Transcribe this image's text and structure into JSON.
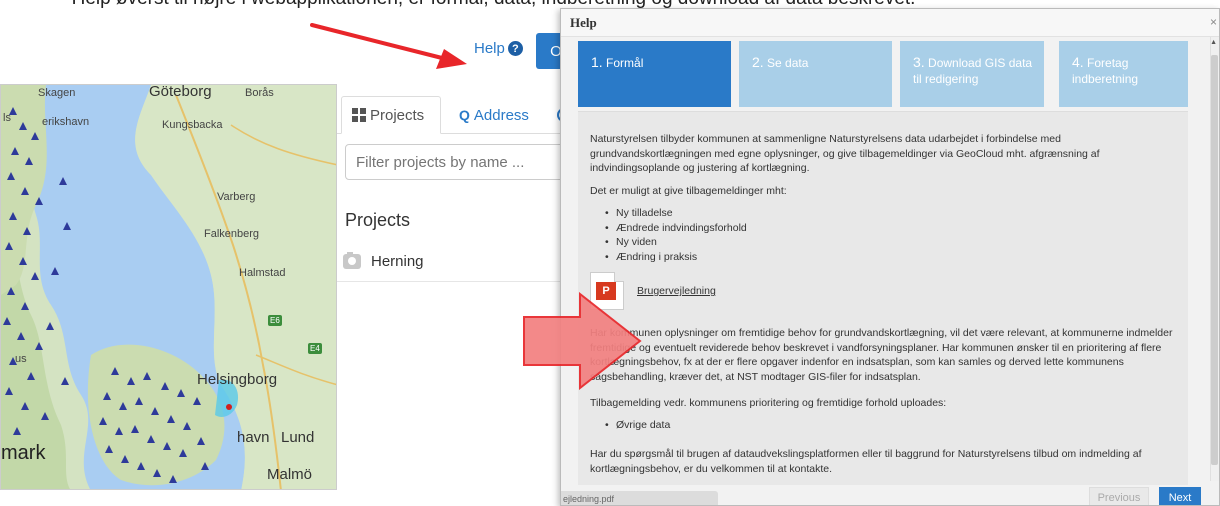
{
  "caption": {
    "text": "- Help   øverst til højre i webapplikationen, er formål, data, indberetning og download af data beskrevet."
  },
  "header": {
    "help_label": "Help",
    "help_icon": "question-circle-icon",
    "o_button_label": "O"
  },
  "map": {
    "labels": {
      "skagen": "Skagen",
      "goteborg": "Göteborg",
      "boras": "Borås",
      "frederikshavn": "erikshavn",
      "kungsbacka": "Kungsbacka",
      "varberg": "Varberg",
      "falkenberg": "Falkenberg",
      "halmstad": "Halmstad",
      "helsingborg": "Helsingborg",
      "lund": "Lund",
      "malmo": "Malmö",
      "havn": "havn",
      "mark": "mark",
      "is": "ls",
      "rus": "us"
    },
    "roads": {
      "e6": "E6",
      "e4": "E4"
    }
  },
  "side_panel": {
    "tabs": [
      {
        "label": "Projects",
        "icon": "grid-icon"
      },
      {
        "label": "Address",
        "icon": "search-icon"
      }
    ],
    "filter_placeholder": "Filter projects by name ...",
    "projects_heading": "Projects",
    "projects": [
      {
        "name": "Herning",
        "icon": "camera-icon"
      }
    ]
  },
  "dialog": {
    "title": "Help",
    "close_glyph": "×",
    "steps": [
      {
        "num": "1.",
        "label": "Formål"
      },
      {
        "num": "2.",
        "label": "Se data"
      },
      {
        "num": "3.",
        "label": "Download GIS data til redigering"
      },
      {
        "num": "4.",
        "label": "Foretag indberetning"
      }
    ],
    "para1": "Naturstyrelsen tilbyder kommunen at sammenligne Naturstyrelsens data udarbejdet i forbindelse med grundvandskortlægningen med egne oplysninger, og give tilbagemeldinger via GeoCloud mht. afgrænsning af indvindingsoplande og justering af kortlægning.",
    "para2": "Det er muligt at give tilbagemeldinger mht:",
    "list1": [
      "Ny tilladelse",
      "Ændrede indvindingsforhold",
      "Ny viden",
      "Ændring i praksis"
    ],
    "pdf_link": "Brugervejledning",
    "pdf_badge": "P",
    "para3": "Har kommunen oplysninger om fremtidige behov for grundvandskortlægning, vil det være relevant, at kommunerne indmelder fremtidige og eventuelt reviderede behov beskrevet i vandforsyningsplaner. Har kommunen ønsker til en prioritering af flere kortlægningsbehov, fx at der er flere opgaver indenfor en indsatsplan, som kan samles og derved lette kommunens sagsbehandling, kræver det, at NST modtager GIS-filer for indsatsplan.",
    "para4": "Tilbagemelding vedr. kommunens prioritering og fremtidige forhold uploades:",
    "list2": [
      "Øvrige data"
    ],
    "para5": "Har du spørgsmål til brugen af dataudvekslingsplatformen eller til baggrund for Naturstyrelsens tilbud om indmelding af kortlægningsbehov, er du velkommen til at kontakte.",
    "prev_label": "Previous",
    "next_label": "Next"
  },
  "footer": {
    "file_label": "ejledning.pdf"
  },
  "colors": {
    "accent": "#2a7ac8",
    "step_inactive": "#a9cfe8",
    "annotation_red": "#e8262a",
    "big_arrow_fill": "#f28080"
  }
}
